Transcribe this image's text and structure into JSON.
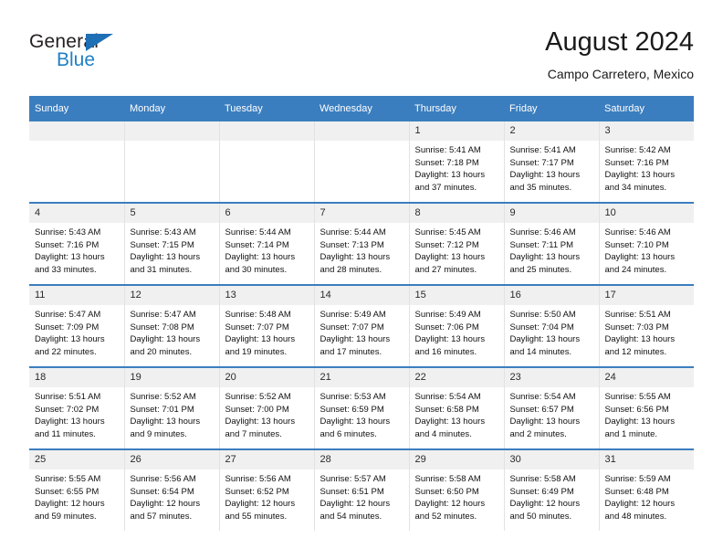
{
  "brand": {
    "name_top": "General",
    "name_bottom": "Blue",
    "accent_color": "#1f7fc6",
    "header_color": "#3b7ebf"
  },
  "header": {
    "title": "August 2024",
    "subtitle": "Campo Carretero, Mexico"
  },
  "weekdays": [
    "Sunday",
    "Monday",
    "Tuesday",
    "Wednesday",
    "Thursday",
    "Friday",
    "Saturday"
  ],
  "labels": {
    "sunrise": "Sunrise:",
    "sunset": "Sunset:",
    "daylight": "Daylight:"
  },
  "weeks": [
    [
      {
        "day": "",
        "empty": true
      },
      {
        "day": "",
        "empty": true
      },
      {
        "day": "",
        "empty": true
      },
      {
        "day": "",
        "empty": true
      },
      {
        "day": "1",
        "sunrise": "Sunrise: 5:41 AM",
        "sunset": "Sunset: 7:18 PM",
        "daylight1": "Daylight: 13 hours",
        "daylight2": "and 37 minutes."
      },
      {
        "day": "2",
        "sunrise": "Sunrise: 5:41 AM",
        "sunset": "Sunset: 7:17 PM",
        "daylight1": "Daylight: 13 hours",
        "daylight2": "and 35 minutes."
      },
      {
        "day": "3",
        "sunrise": "Sunrise: 5:42 AM",
        "sunset": "Sunset: 7:16 PM",
        "daylight1": "Daylight: 13 hours",
        "daylight2": "and 34 minutes."
      }
    ],
    [
      {
        "day": "4",
        "sunrise": "Sunrise: 5:43 AM",
        "sunset": "Sunset: 7:16 PM",
        "daylight1": "Daylight: 13 hours",
        "daylight2": "and 33 minutes."
      },
      {
        "day": "5",
        "sunrise": "Sunrise: 5:43 AM",
        "sunset": "Sunset: 7:15 PM",
        "daylight1": "Daylight: 13 hours",
        "daylight2": "and 31 minutes."
      },
      {
        "day": "6",
        "sunrise": "Sunrise: 5:44 AM",
        "sunset": "Sunset: 7:14 PM",
        "daylight1": "Daylight: 13 hours",
        "daylight2": "and 30 minutes."
      },
      {
        "day": "7",
        "sunrise": "Sunrise: 5:44 AM",
        "sunset": "Sunset: 7:13 PM",
        "daylight1": "Daylight: 13 hours",
        "daylight2": "and 28 minutes."
      },
      {
        "day": "8",
        "sunrise": "Sunrise: 5:45 AM",
        "sunset": "Sunset: 7:12 PM",
        "daylight1": "Daylight: 13 hours",
        "daylight2": "and 27 minutes."
      },
      {
        "day": "9",
        "sunrise": "Sunrise: 5:46 AM",
        "sunset": "Sunset: 7:11 PM",
        "daylight1": "Daylight: 13 hours",
        "daylight2": "and 25 minutes."
      },
      {
        "day": "10",
        "sunrise": "Sunrise: 5:46 AM",
        "sunset": "Sunset: 7:10 PM",
        "daylight1": "Daylight: 13 hours",
        "daylight2": "and 24 minutes."
      }
    ],
    [
      {
        "day": "11",
        "sunrise": "Sunrise: 5:47 AM",
        "sunset": "Sunset: 7:09 PM",
        "daylight1": "Daylight: 13 hours",
        "daylight2": "and 22 minutes."
      },
      {
        "day": "12",
        "sunrise": "Sunrise: 5:47 AM",
        "sunset": "Sunset: 7:08 PM",
        "daylight1": "Daylight: 13 hours",
        "daylight2": "and 20 minutes."
      },
      {
        "day": "13",
        "sunrise": "Sunrise: 5:48 AM",
        "sunset": "Sunset: 7:07 PM",
        "daylight1": "Daylight: 13 hours",
        "daylight2": "and 19 minutes."
      },
      {
        "day": "14",
        "sunrise": "Sunrise: 5:49 AM",
        "sunset": "Sunset: 7:07 PM",
        "daylight1": "Daylight: 13 hours",
        "daylight2": "and 17 minutes."
      },
      {
        "day": "15",
        "sunrise": "Sunrise: 5:49 AM",
        "sunset": "Sunset: 7:06 PM",
        "daylight1": "Daylight: 13 hours",
        "daylight2": "and 16 minutes."
      },
      {
        "day": "16",
        "sunrise": "Sunrise: 5:50 AM",
        "sunset": "Sunset: 7:04 PM",
        "daylight1": "Daylight: 13 hours",
        "daylight2": "and 14 minutes."
      },
      {
        "day": "17",
        "sunrise": "Sunrise: 5:51 AM",
        "sunset": "Sunset: 7:03 PM",
        "daylight1": "Daylight: 13 hours",
        "daylight2": "and 12 minutes."
      }
    ],
    [
      {
        "day": "18",
        "sunrise": "Sunrise: 5:51 AM",
        "sunset": "Sunset: 7:02 PM",
        "daylight1": "Daylight: 13 hours",
        "daylight2": "and 11 minutes."
      },
      {
        "day": "19",
        "sunrise": "Sunrise: 5:52 AM",
        "sunset": "Sunset: 7:01 PM",
        "daylight1": "Daylight: 13 hours",
        "daylight2": "and 9 minutes."
      },
      {
        "day": "20",
        "sunrise": "Sunrise: 5:52 AM",
        "sunset": "Sunset: 7:00 PM",
        "daylight1": "Daylight: 13 hours",
        "daylight2": "and 7 minutes."
      },
      {
        "day": "21",
        "sunrise": "Sunrise: 5:53 AM",
        "sunset": "Sunset: 6:59 PM",
        "daylight1": "Daylight: 13 hours",
        "daylight2": "and 6 minutes."
      },
      {
        "day": "22",
        "sunrise": "Sunrise: 5:54 AM",
        "sunset": "Sunset: 6:58 PM",
        "daylight1": "Daylight: 13 hours",
        "daylight2": "and 4 minutes."
      },
      {
        "day": "23",
        "sunrise": "Sunrise: 5:54 AM",
        "sunset": "Sunset: 6:57 PM",
        "daylight1": "Daylight: 13 hours",
        "daylight2": "and 2 minutes."
      },
      {
        "day": "24",
        "sunrise": "Sunrise: 5:55 AM",
        "sunset": "Sunset: 6:56 PM",
        "daylight1": "Daylight: 13 hours",
        "daylight2": "and 1 minute."
      }
    ],
    [
      {
        "day": "25",
        "sunrise": "Sunrise: 5:55 AM",
        "sunset": "Sunset: 6:55 PM",
        "daylight1": "Daylight: 12 hours",
        "daylight2": "and 59 minutes."
      },
      {
        "day": "26",
        "sunrise": "Sunrise: 5:56 AM",
        "sunset": "Sunset: 6:54 PM",
        "daylight1": "Daylight: 12 hours",
        "daylight2": "and 57 minutes."
      },
      {
        "day": "27",
        "sunrise": "Sunrise: 5:56 AM",
        "sunset": "Sunset: 6:52 PM",
        "daylight1": "Daylight: 12 hours",
        "daylight2": "and 55 minutes."
      },
      {
        "day": "28",
        "sunrise": "Sunrise: 5:57 AM",
        "sunset": "Sunset: 6:51 PM",
        "daylight1": "Daylight: 12 hours",
        "daylight2": "and 54 minutes."
      },
      {
        "day": "29",
        "sunrise": "Sunrise: 5:58 AM",
        "sunset": "Sunset: 6:50 PM",
        "daylight1": "Daylight: 12 hours",
        "daylight2": "and 52 minutes."
      },
      {
        "day": "30",
        "sunrise": "Sunrise: 5:58 AM",
        "sunset": "Sunset: 6:49 PM",
        "daylight1": "Daylight: 12 hours",
        "daylight2": "and 50 minutes."
      },
      {
        "day": "31",
        "sunrise": "Sunrise: 5:59 AM",
        "sunset": "Sunset: 6:48 PM",
        "daylight1": "Daylight: 12 hours",
        "daylight2": "and 48 minutes."
      }
    ]
  ]
}
